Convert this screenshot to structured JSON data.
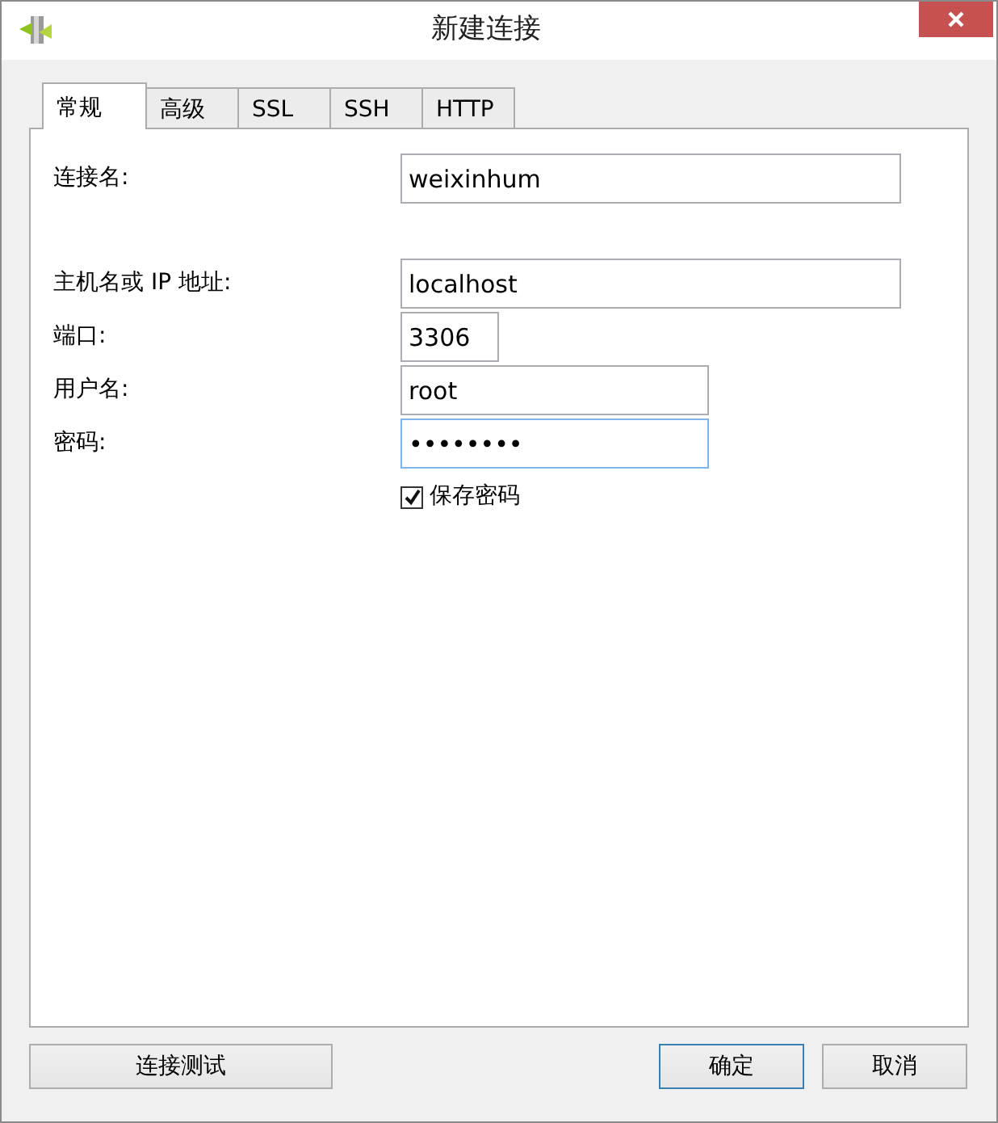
{
  "window": {
    "title": "新建连接"
  },
  "tabs": [
    {
      "label": "常规",
      "selected": true
    },
    {
      "label": "高级",
      "selected": false
    },
    {
      "label": "SSL",
      "selected": false
    },
    {
      "label": "SSH",
      "selected": false
    },
    {
      "label": "HTTP",
      "selected": false
    }
  ],
  "fields": [
    {
      "label": "连接名:",
      "value": "weixinhum",
      "focused": false
    },
    {
      "label": "主机名或 IP 地址:",
      "value": "localhost",
      "focused": false
    },
    {
      "label": "端口:",
      "value": "3306",
      "focused": false
    },
    {
      "label": "用户名:",
      "value": "root",
      "focused": false
    },
    {
      "label": "密码:",
      "value": "••••••••",
      "focused": true
    }
  ],
  "save_password": {
    "label": "保存密码",
    "checked": true
  },
  "buttons": [
    {
      "label": "连接测试",
      "focused": false
    },
    {
      "label": "确定",
      "focused": true
    },
    {
      "label": "取消",
      "focused": false
    }
  ]
}
